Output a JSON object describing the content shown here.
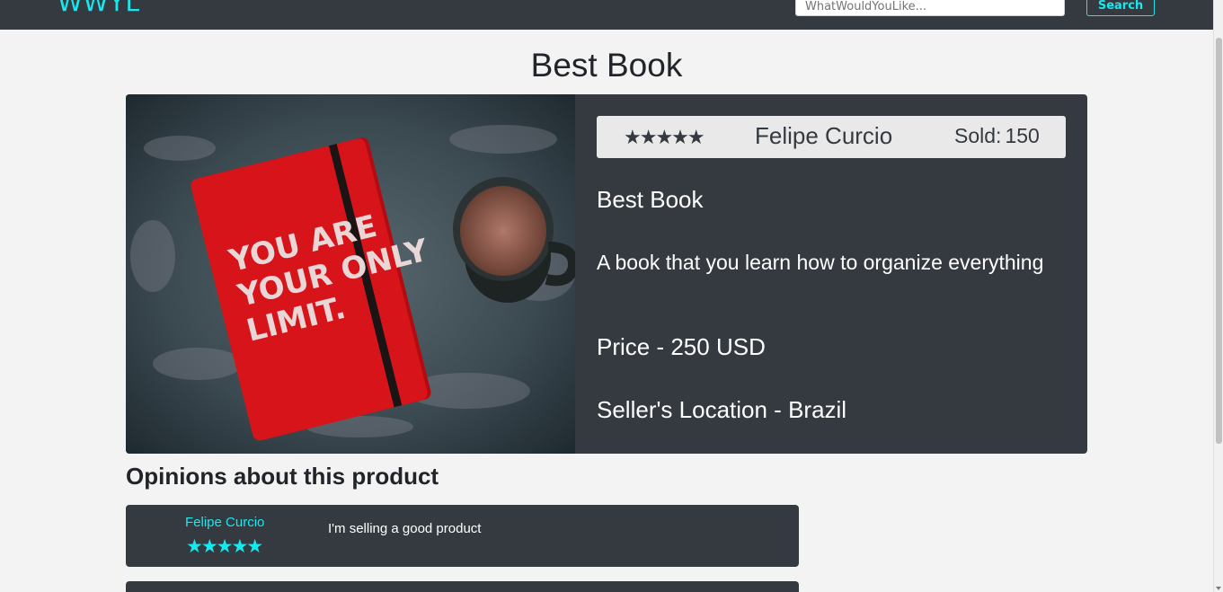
{
  "navbar": {
    "brand": "WWYL",
    "search_placeholder": "WhatWouldYouLike...",
    "search_label": "Search"
  },
  "page": {
    "title": "Best Book"
  },
  "product": {
    "rating_stars": "★★★★★",
    "seller": "Felipe Curcio",
    "sold_label": "Sold:",
    "sold_value": "150",
    "name": "Best Book",
    "description": "A book that you learn how to organize everything",
    "price": "Price - 250 USD",
    "location": "Seller's Location - Brazil",
    "image_text": "YOU ARE YOUR ONLY LIMIT."
  },
  "opinions": {
    "title": "Opinions about this product",
    "reviews": [
      {
        "author": "Felipe Curcio",
        "stars": "★★★★★",
        "text": "I'm selling a good product"
      }
    ]
  },
  "colors": {
    "accent": "#17e8ee",
    "dark": "#343a40",
    "background": "#f3f3f3"
  }
}
